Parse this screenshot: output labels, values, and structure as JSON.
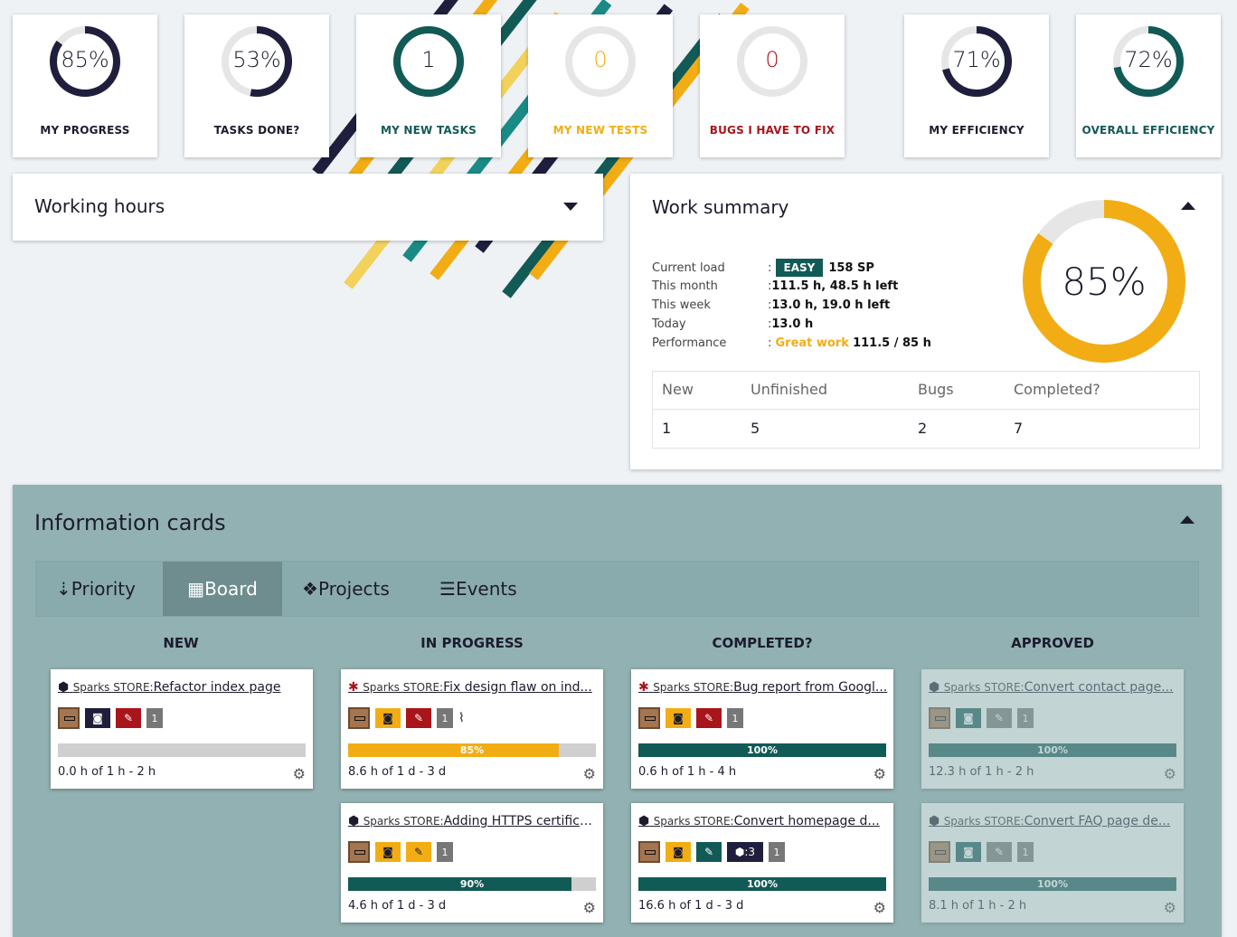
{
  "colors": {
    "navy": "#1f1f3d",
    "teal": "#125a56",
    "yellow": "#f2ad14",
    "red": "#a8151b",
    "gray": "#e6e6e6"
  },
  "tiles": [
    {
      "value": "85%",
      "label": "MY PROGRESS",
      "percent": 85,
      "ring_color": "#1f1f3d",
      "label_color": "#1c1c2e"
    },
    {
      "value": "53%",
      "label": "TASKS DONE?",
      "percent": 53,
      "ring_color": "#1f1f3d",
      "label_color": "#1c1c2e"
    },
    {
      "value": "1",
      "label": "MY NEW TASKS",
      "percent": 100,
      "ring_color": "#125a56",
      "label_color": "#125a56"
    },
    {
      "value": "0",
      "label": "MY NEW TESTS",
      "percent": 0,
      "ring_color": "#f2ad14",
      "label_color": "#f2ad14"
    },
    {
      "value": "0",
      "label": "BUGS I HAVE TO FIX",
      "percent": 0,
      "ring_color": "#a8151b",
      "label_color": "#a8151b"
    },
    {
      "value": "71%",
      "label": "MY EFFICIENCY",
      "percent": 71,
      "ring_color": "#1f1f3d",
      "label_color": "#1c1c2e"
    },
    {
      "value": "72%",
      "label": "OVERALL EFFICIENCY",
      "percent": 72,
      "ring_color": "#125a56",
      "label_color": "#125a56"
    }
  ],
  "working_hours": {
    "title": "Working hours"
  },
  "work_summary": {
    "title": "Work summary",
    "current_load_label": "Current load",
    "load_badge": "EASY",
    "load_value": "158 SP",
    "month_label": "This month",
    "month_value": "111.5 h, 48.5 h left",
    "week_label": "This week",
    "week_value": "13.0 h, 19.0 h left",
    "today_label": "Today",
    "today_value": "13.0 h",
    "performance_label": "Performance",
    "performance_note": "Great work",
    "performance_value": "111.5 / 85 h",
    "donut_value": "85%",
    "donut_percent": 85,
    "table_headers": [
      "New",
      "Unfinished",
      "Bugs",
      "Completed?"
    ],
    "table_values": [
      "1",
      "5",
      "2",
      "7"
    ]
  },
  "info_cards": {
    "title": "Information cards",
    "tabs": [
      {
        "icon": "priority-icon",
        "label": "Priority"
      },
      {
        "icon": "board-icon",
        "label": "Board"
      },
      {
        "icon": "projects-icon",
        "label": "Projects"
      },
      {
        "icon": "events-icon",
        "label": "Events"
      }
    ],
    "columns": [
      "NEW",
      "IN PROGRESS",
      "COMPLETED?",
      "APPROVED"
    ],
    "cards": [
      {
        "project": "Sparks STORE:",
        "title": "Refactor index page",
        "type_icon": "cube-icon",
        "percent_text": "",
        "progress": 0,
        "bar_color": "#cfcfcf",
        "hours": "0.0 h of 1 h - 2 h"
      },
      {
        "project": "Sparks STORE:",
        "title": "Fix design flaw on ind...",
        "type_icon": "bug-icon",
        "percent_text": "85%",
        "progress": 85,
        "bar_color": "#f2ad14",
        "hours": "8.6 h of 1 d - 3 d"
      },
      {
        "project": "Sparks STORE:",
        "title": "Adding HTTPS certifica...",
        "type_icon": "cube-icon",
        "percent_text": "90%",
        "progress": 90,
        "bar_color": "#125a56",
        "hours": "4.6 h of 1 d - 3 d"
      },
      {
        "project": "Sparks STORE:",
        "title": "Bug report from Googl...",
        "type_icon": "bug-icon",
        "percent_text": "100%",
        "progress": 100,
        "bar_color": "#125a56",
        "hours": "0.6 h of 1 h - 4 h"
      },
      {
        "project": "Sparks STORE:",
        "title": "Convert homepage d...",
        "type_icon": "cube-icon",
        "percent_text": "100%",
        "progress": 100,
        "bar_color": "#125a56",
        "hours": "16.6 h of 1 d - 3 d",
        "subtask_count": ":3"
      },
      {
        "project": "Sparks STORE:",
        "title": "Convert contact page...",
        "type_icon": "cube-icon",
        "percent_text": "100%",
        "progress": 100,
        "bar_color": "#125a56",
        "hours": "12.3 h of 1 h - 2 h"
      },
      {
        "project": "Sparks STORE:",
        "title": "Convert FAQ page de...",
        "type_icon": "cube-icon",
        "percent_text": "100%",
        "progress": 100,
        "bar_color": "#125a56",
        "hours": "8.1 h of 1 h - 2 h"
      }
    ],
    "count_badge": "1"
  }
}
